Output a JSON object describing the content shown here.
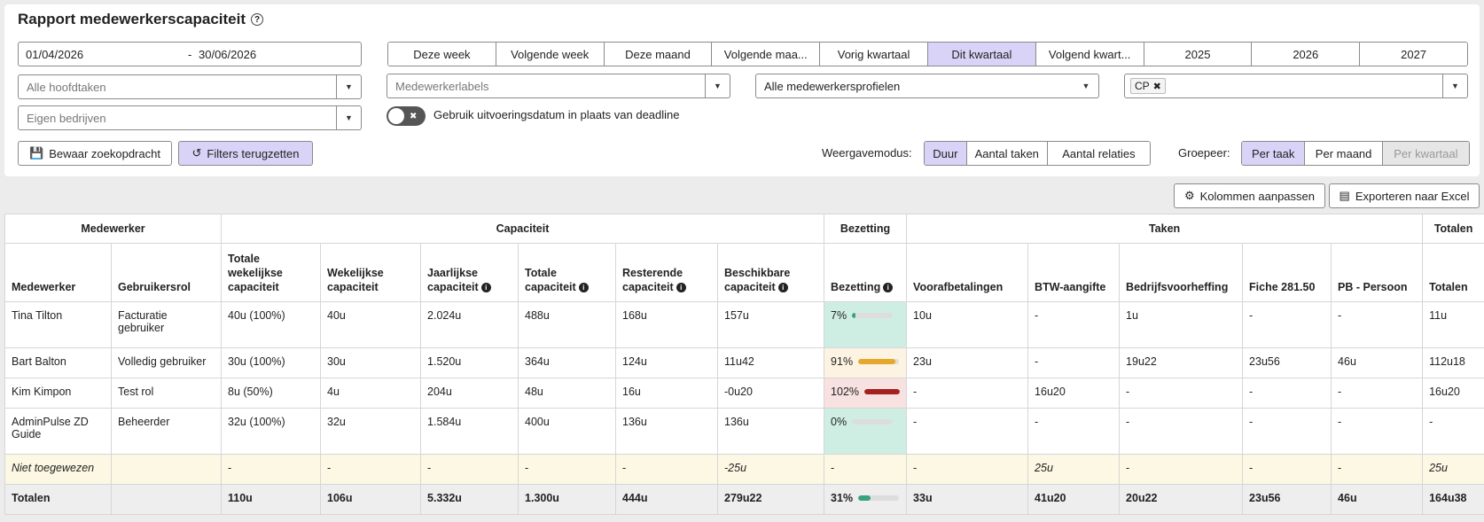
{
  "header": {
    "title": "Rapport medewerkerscapaciteit"
  },
  "filters": {
    "date_from": "01/04/2026",
    "date_sep": "-",
    "date_to": "30/06/2026",
    "periods": [
      "Deze week",
      "Volgende week",
      "Deze maand",
      "Volgende maa...",
      "Vorig kwartaal",
      "Dit kwartaal",
      "Volgend kwart...",
      "2025",
      "2026",
      "2027"
    ],
    "active_period": "Dit kwartaal",
    "main_tasks_placeholder": "Alle hoofdtaken",
    "employee_labels_placeholder": "Medewerkerlabels",
    "employee_profiles_value": "Alle medewerkersprofielen",
    "tag": "CP",
    "own_companies_placeholder": "Eigen bedrijven",
    "toggle_label": "Gebruik uitvoeringsdatum in plaats van deadline",
    "save_search": "Bewaar zoekopdracht",
    "reset_filters": "Filters terugzetten",
    "display_mode_label": "Weergavemodus:",
    "display_modes": [
      "Duur",
      "Aantal taken",
      "Aantal relaties"
    ],
    "active_display_mode": "Duur",
    "group_label": "Groepeer:",
    "group_modes": [
      "Per taak",
      "Per maand",
      "Per kwartaal"
    ],
    "active_group_mode": "Per taak",
    "disabled_group_mode": "Per kwartaal"
  },
  "actions": {
    "customize_columns": "Kolommen aanpassen",
    "export_excel": "Exporteren naar Excel"
  },
  "table": {
    "groups": [
      "Medewerker",
      "Capaciteit",
      "Bezetting",
      "Taken",
      "Totalen"
    ],
    "columns": [
      "Medewerker",
      "Gebruikersrol",
      "Totale wekelijkse capaciteit",
      "Wekelijkse capaciteit",
      "Jaarlijkse capaciteit",
      "Totale capaciteit",
      "Resterende capaciteit",
      "Beschikbare capaciteit",
      "Bezetting",
      "Voorafbetalingen",
      "BTW-aangifte",
      "Bedrijfsvoorheffing",
      "Fiche 281.50",
      "PB - Persoon",
      "Totalen"
    ],
    "rows": [
      {
        "cells": [
          "Tina Tilton",
          "Facturatie gebruiker",
          "40u (100%)",
          "40u",
          "2.024u",
          "488u",
          "168u",
          "157u",
          "7%",
          "10u",
          "-",
          "1u",
          "-",
          "-",
          "11u"
        ],
        "occupancy": 7,
        "bar_color": "#3aa17e",
        "bg": "green"
      },
      {
        "cells": [
          "Bart Balton",
          "Volledig gebruiker",
          "30u (100%)",
          "30u",
          "1.520u",
          "364u",
          "124u",
          "11u42",
          "91%",
          "23u",
          "-",
          "19u22",
          "23u56",
          "46u",
          "112u18"
        ],
        "occupancy": 91,
        "bar_color": "#e5a82c",
        "bg": "orange"
      },
      {
        "cells": [
          "Kim Kimpon",
          "Test rol",
          "8u (50%)",
          "4u",
          "204u",
          "48u",
          "16u",
          "-0u20",
          "102%",
          "-",
          "16u20",
          "-",
          "-",
          "-",
          "16u20"
        ],
        "occupancy": 100,
        "bar_color": "#a3211e",
        "bg": "red"
      },
      {
        "cells": [
          "AdminPulse ZD Guide",
          "Beheerder",
          "32u (100%)",
          "32u",
          "1.584u",
          "400u",
          "136u",
          "136u",
          "0%",
          "-",
          "-",
          "-",
          "-",
          "-",
          "-"
        ],
        "occupancy": 0,
        "bar_color": "#3aa17e",
        "bg": "green"
      }
    ],
    "unassigned": [
      "Niet toegewezen",
      "",
      "-",
      "-",
      "-",
      "-",
      "-",
      "-25u",
      "-",
      "-",
      "25u",
      "-",
      "-",
      "-",
      "25u"
    ],
    "totals": {
      "cells": [
        "Totalen",
        "",
        "110u",
        "106u",
        "5.332u",
        "1.300u",
        "444u",
        "279u22",
        "31%",
        "33u",
        "41u20",
        "20u22",
        "23u56",
        "46u",
        "164u38"
      ],
      "occupancy": 31,
      "bar_color": "#3aa17e"
    }
  }
}
